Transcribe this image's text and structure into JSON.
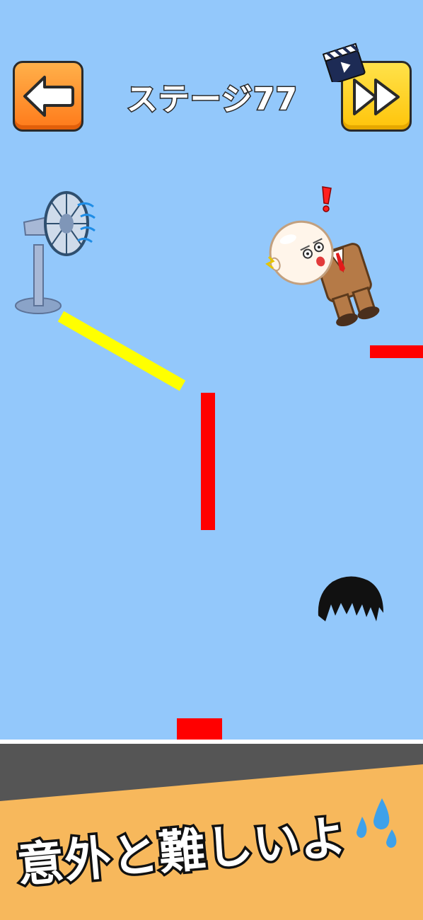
{
  "header": {
    "stage_title": "ステージ77",
    "back_icon": "arrow-left-icon",
    "skip_icon": "fast-forward-icon",
    "ad_icon": "clapperboard-video-icon"
  },
  "scene": {
    "fan": "electric-fan-icon",
    "character": "bald-businessman",
    "wig": "black-hair-wig",
    "exclamation": "!"
  },
  "caption": {
    "text": "意外と難しいよ",
    "emoji": "sweat-drops-icon"
  },
  "colors": {
    "sky": "#93c8fb",
    "wall": "#ff0000",
    "drawn_line": "#ffff00",
    "banner": "#f7b85c",
    "back_button": "#ff8a1f",
    "skip_button": "#ffcf1a"
  }
}
